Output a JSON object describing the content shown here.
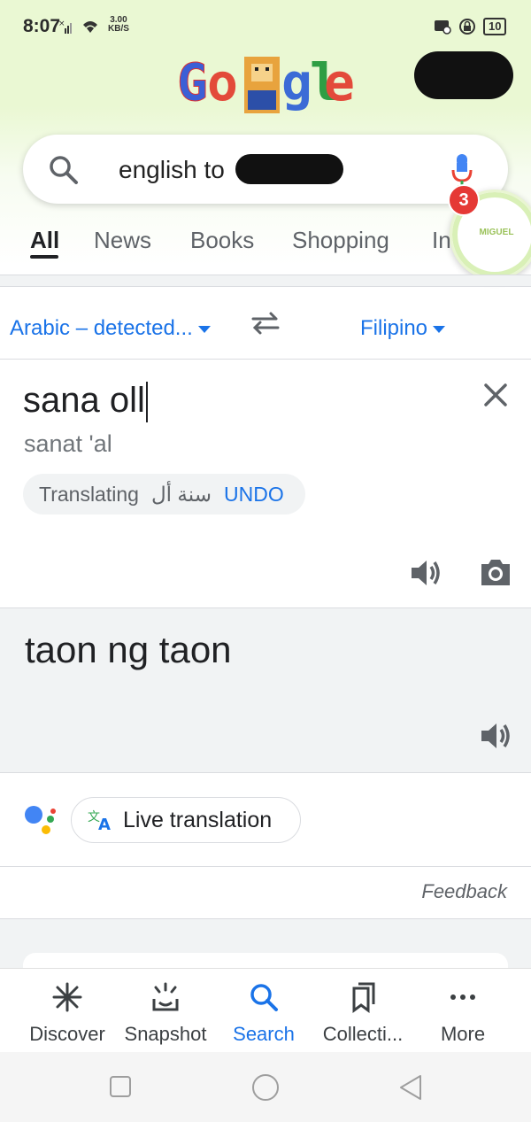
{
  "status": {
    "time": "8:07",
    "speed_value": "3.00",
    "speed_unit": "KB/S",
    "battery": "10"
  },
  "logo": {
    "text": "Google"
  },
  "search": {
    "query": "english to",
    "notification_count": "3",
    "bubble_label": "MIGUEL"
  },
  "tabs": [
    {
      "label": "All",
      "active": true
    },
    {
      "label": "News"
    },
    {
      "label": "Books"
    },
    {
      "label": "Shopping"
    },
    {
      "label": "In"
    }
  ],
  "translate": {
    "source_lang": "Arabic – detected...",
    "target_lang": "Filipino",
    "source_text": "sana oll",
    "transliteration": "sanat 'al",
    "chip_prefix": "Translating",
    "chip_arabic": "سنة أل",
    "chip_action": "UNDO",
    "output_text": "taon ng taon",
    "live_translation_label": "Live translation",
    "feedback_label": "Feedback"
  },
  "bottom_nav": [
    {
      "label": "Discover",
      "icon": "discover-icon"
    },
    {
      "label": "Snapshot",
      "icon": "snapshot-icon"
    },
    {
      "label": "Search",
      "icon": "search-icon",
      "active": true
    },
    {
      "label": "Collecti...",
      "icon": "collections-icon"
    },
    {
      "label": "More",
      "icon": "more-icon"
    }
  ],
  "colors": {
    "accent": "#1a73e8",
    "badge": "#e53935",
    "header_bg": "#eaf8d3"
  }
}
